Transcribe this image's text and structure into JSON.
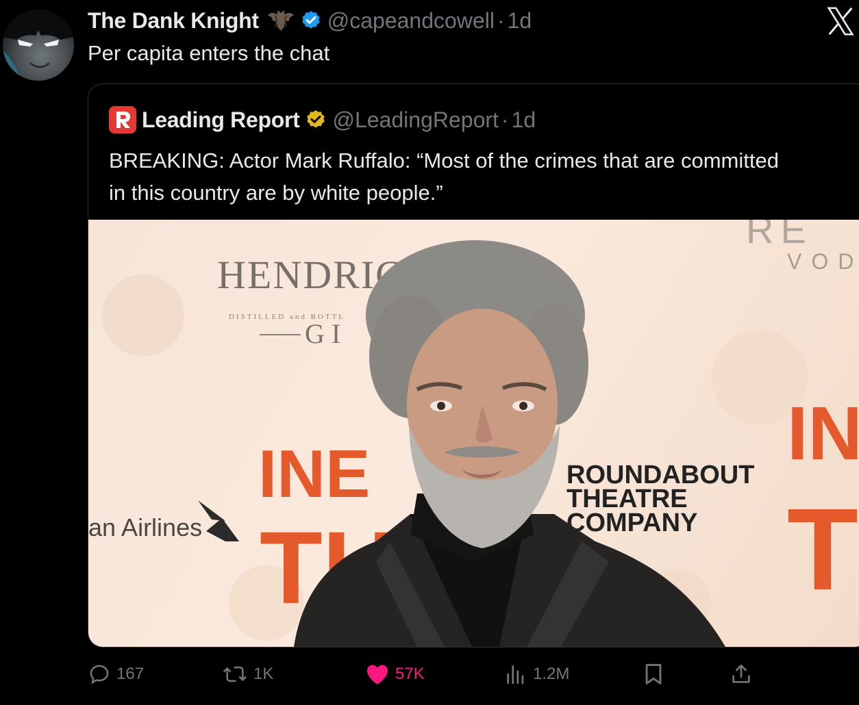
{
  "tweet": {
    "display_name": "The Dank Knight",
    "handle": "@capeandcowell",
    "separator": "·",
    "time": "1d",
    "text": "Per capita enters the chat",
    "icons": {
      "avatar": "batman-avatar",
      "emoji": "bat-emoji-icon",
      "verified": "verified-blue-badge-icon",
      "app_logo": "x-logo-icon"
    }
  },
  "quote": {
    "display_name": "Leading Report",
    "handle": "@LeadingReport",
    "separator": "·",
    "time": "1d",
    "text": "BREAKING: Actor Mark Ruffalo: “Most of the crimes that are committed in this country are by white people.”",
    "logo_icon": "leading-report-logo-icon",
    "verified_icon": "verified-gold-badge-icon",
    "media": {
      "backdrop_texts": {
        "hendricks": "HENDRIC",
        "distilled": "DISTILLED and BOTTL",
        "gin": "GI",
        "airlines": "an Airlines",
        "roundabout_1": "ROUNDABOUT",
        "roundabout_2": "THEATRE",
        "roundabout_3": "COMPANY",
        "red_top": "INE",
        "red_bottom": "TH",
        "right_red_top": "IN",
        "right_red_bottom": "T",
        "top_right_1": "RE",
        "top_right_2": "VOD"
      }
    }
  },
  "actions": {
    "reply": {
      "icon": "reply-icon",
      "count": "167"
    },
    "retweet": {
      "icon": "retweet-icon",
      "count": "1K"
    },
    "like": {
      "icon": "heart-icon",
      "count": "57K"
    },
    "views": {
      "icon": "views-icon",
      "count": "1.2M"
    },
    "bookmark": {
      "icon": "bookmark-icon"
    },
    "share": {
      "icon": "share-icon"
    }
  },
  "colors": {
    "background": "#000000",
    "text": "#e7e9ea",
    "muted": "#71767b",
    "like": "#f91880",
    "verified_blue": "#1d9bf0",
    "verified_gold": "#e2b719",
    "border": "#2f3336"
  }
}
